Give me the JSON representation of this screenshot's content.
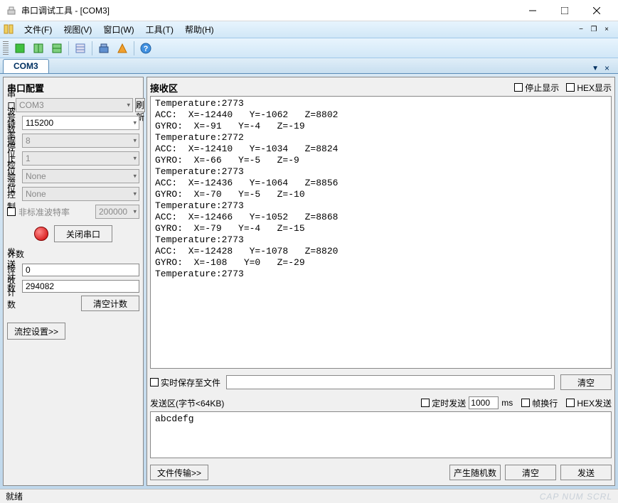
{
  "titlebar": {
    "title": "串口调试工具 - [COM3]"
  },
  "menubar": {
    "file": "文件(F)",
    "view": "视图(V)",
    "window": "窗口(W)",
    "tools": "工具(T)",
    "help": "帮助(H)"
  },
  "tab": {
    "label": "COM3"
  },
  "config": {
    "title": "串口配置",
    "port_label": "串口号",
    "port_value": "COM3",
    "refresh": "刷新",
    "baud_label": "波特率",
    "baud_value": "115200",
    "data_label": "数据位",
    "data_value": "8",
    "stop_label": "停止位",
    "stop_value": "1",
    "parity_label": "检验位",
    "parity_value": "None",
    "flow_label": "流控制",
    "flow_value": "None",
    "nonstd_label": "非标准波特率",
    "nonstd_value": "200000",
    "close_port": "关闭串口"
  },
  "count": {
    "title": "计数",
    "send_label": "发送计数",
    "send_value": "0",
    "recv_label": "接收计数",
    "recv_value": "294082",
    "clear": "清空计数"
  },
  "flow_settings": "流控设置>>",
  "recv": {
    "title": "接收区",
    "stop_display": "停止显示",
    "hex_display": "HEX显示",
    "content": "Temperature:2773\nACC:  X=-12440   Y=-1062   Z=8802\nGYRO:  X=-91   Y=-4   Z=-19\nTemperature:2772\nACC:  X=-12410   Y=-1034   Z=8824\nGYRO:  X=-66   Y=-5   Z=-9\nTemperature:2773\nACC:  X=-12436   Y=-1064   Z=8856\nGYRO:  X=-70   Y=-5   Z=-10\nTemperature:2773\nACC:  X=-12466   Y=-1052   Z=8868\nGYRO:  X=-79   Y=-4   Z=-15\nTemperature:2773\nACC:  X=-12428   Y=-1078   Z=8820\nGYRO:  X=-108   Y=0   Z=-29\nTemperature:2773"
  },
  "save": {
    "label": "实时保存至文件",
    "clear": "清空"
  },
  "send": {
    "title": "发送区(字节<64KB)",
    "timer_label": "定时发送",
    "timer_value": "1000",
    "timer_unit": "ms",
    "newline": "帧换行",
    "hex": "HEX发送",
    "content": "abcdefg",
    "file_transfer": "文件传输>>",
    "random": "产生随机数",
    "clear": "清空",
    "send_btn": "发送"
  },
  "status": {
    "text": "就绪",
    "right": "CAP NUM SCRL"
  }
}
